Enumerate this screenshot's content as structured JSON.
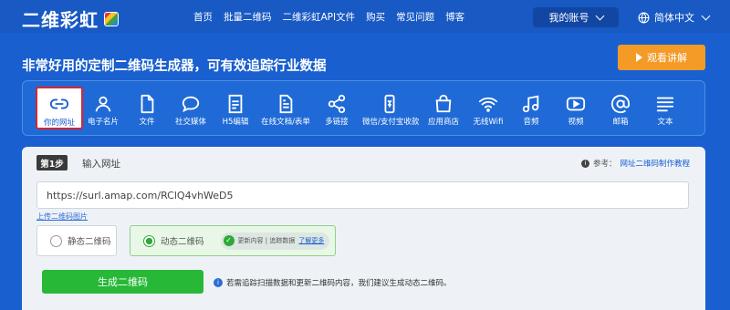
{
  "nav": {
    "logo": "二维彩虹",
    "links": [
      "首页",
      "批量二维码",
      "二维彩虹API文件",
      "购买",
      "常见问题",
      "博客"
    ],
    "account": "我的账号",
    "language": "简体中文"
  },
  "hero": {
    "headline": "非常好用的定制二维码生成器，可有效追踪行业数据",
    "watch_button": "观看讲解"
  },
  "types": [
    {
      "label": "你的网址",
      "icon": "link-icon"
    },
    {
      "label": "电子名片",
      "icon": "person-icon"
    },
    {
      "label": "文件",
      "icon": "file-icon"
    },
    {
      "label": "社交媒体",
      "icon": "chat-bubble-icon"
    },
    {
      "label": "H5编辑",
      "icon": "html-icon"
    },
    {
      "label": "在线文档/表单",
      "icon": "document-icon"
    },
    {
      "label": "多链接",
      "icon": "share-icon"
    },
    {
      "label": "微信/支付宝收款",
      "icon": "payment-icon"
    },
    {
      "label": "应用商店",
      "icon": "store-bag-icon"
    },
    {
      "label": "无线Wifi",
      "icon": "wifi-icon"
    },
    {
      "label": "音频",
      "icon": "music-note-icon"
    },
    {
      "label": "视频",
      "icon": "video-icon"
    },
    {
      "label": "邮箱",
      "icon": "at-sign-icon"
    },
    {
      "label": "文本",
      "icon": "text-lines-icon"
    }
  ],
  "form": {
    "step_badge": "第1步",
    "step_title": "输入网址",
    "ref_label": "参考：",
    "ref_link": "网址二维码制作教程",
    "url_value": "https://surl.amap.com/RClQ4vhWeD5",
    "upload_link": "上传二维码图片",
    "static_option": "静态二维码",
    "dynamic_option": "动态二维码",
    "dyn_features": "更新内容 | 追踪数据",
    "learn_more": "了解更多",
    "generate_button": "生成二维码",
    "hint": "若需追踪扫描数据和更新二维码内容，我们建议生成动态二维码。"
  },
  "colors": {
    "brand_blue": "#1a5fcf",
    "accent_orange": "#f39a27",
    "success_green": "#27b838",
    "selected_outline": "#d9262c"
  }
}
